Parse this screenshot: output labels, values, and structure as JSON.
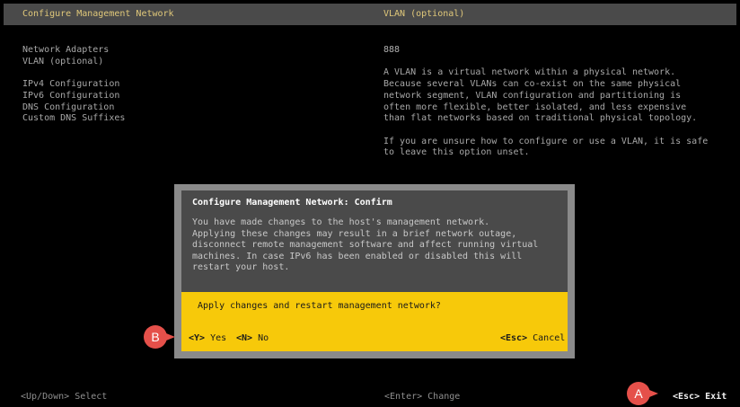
{
  "header": {
    "left_title": "Configure Management Network",
    "right_title": "VLAN (optional)"
  },
  "menu": {
    "items": [
      "Network Adapters",
      "VLAN (optional)",
      "IPv4 Configuration",
      "IPv6 Configuration",
      "DNS Configuration",
      "Custom DNS Suffixes"
    ]
  },
  "details": {
    "value": "888",
    "description": [
      "A VLAN is a virtual network within a physical network.",
      "Because several VLANs can co-exist on the same physical",
      "network segment, VLAN configuration and partitioning is",
      "often more flexible, better isolated, and less expensive",
      "than flat networks based on traditional physical topology."
    ],
    "hint": [
      "If you are unsure how to configure or use a VLAN, it is safe",
      "to leave this option unset."
    ]
  },
  "dialog": {
    "title": "Configure Management Network: Confirm",
    "body": "You have made changes to the host's management network.\nApplying these changes may result in a brief network outage,\ndisconnect remote management software and affect running virtual\nmachines. In case IPv6 has been enabled or disabled this will\nrestart your host.",
    "question": "Apply changes and restart management network?",
    "yes_key": "<Y>",
    "yes_label": "Yes",
    "no_key": "<N>",
    "no_label": "No",
    "cancel_key": "<Esc>",
    "cancel_label": "Cancel"
  },
  "footer": {
    "select_hint": "<Up/Down> Select",
    "change_hint": "<Enter> Change",
    "exit_key": "<Esc>",
    "exit_label": "Exit"
  },
  "annotations": {
    "marker_a": "A",
    "marker_b": "B",
    "marker_color": "#e5504a"
  },
  "colors": {
    "accent_yellow": "#f7c90a",
    "title_text": "#e0c87a"
  }
}
